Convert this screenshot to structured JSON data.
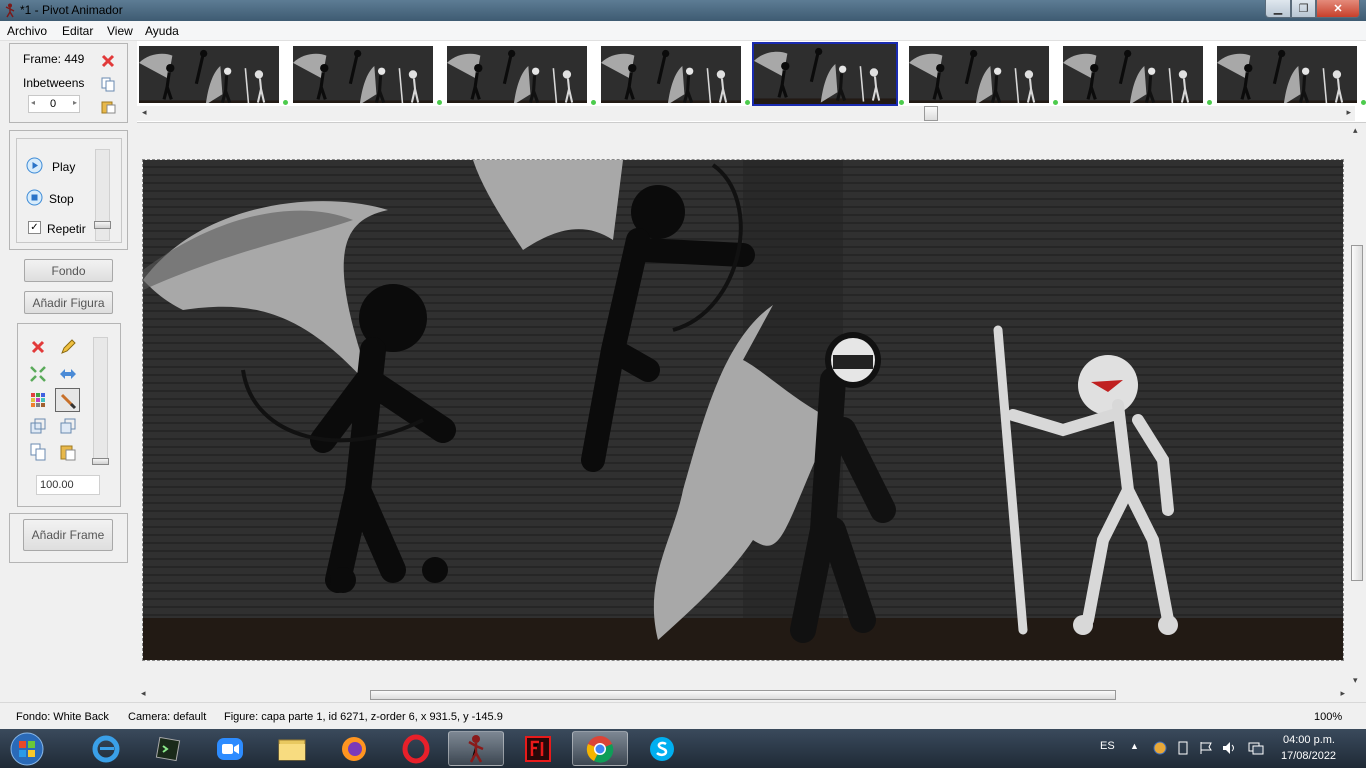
{
  "window": {
    "title": "*1 - Pivot Animador"
  },
  "menu": [
    "Archivo",
    "Editar",
    "View",
    "Ayuda"
  ],
  "frame_panel": {
    "frame_label": "Frame: 449",
    "inbetweens_label": "Inbetweens",
    "inbetweens_value": "0"
  },
  "playback": {
    "play": "Play",
    "stop": "Stop",
    "repeat": "Repetir",
    "repeat_checked": true
  },
  "buttons": {
    "fondo": "Fondo",
    "add_figure": "Añadir Figura",
    "add_frame": "Añadir Frame"
  },
  "figure_tools": {
    "scale_value": "100.00"
  },
  "timeline": {
    "thumb_count": 8,
    "selected_index": 4
  },
  "status": {
    "fondo": "Fondo: White Back",
    "camera": "Camera: default",
    "figure": "Figure: capa parte 1,  id 6271,  z-order 6,  x 931.5, y -145.9",
    "zoom": "100%"
  },
  "taskbar": {
    "apps": [
      "start-orb",
      "internet-explorer",
      "terminal",
      "zoom",
      "file-explorer",
      "firefox",
      "opera",
      "pivot-animator",
      "flash",
      "chrome",
      "skype"
    ],
    "language": "ES",
    "time": "04:00 p.m.",
    "date": "17/08/2022"
  },
  "colors": {
    "selection": "#1a2bb0",
    "keyframe_dot": "#4ccb4c",
    "stage_bg": "#2e2e2e",
    "ground": "#221a14"
  }
}
